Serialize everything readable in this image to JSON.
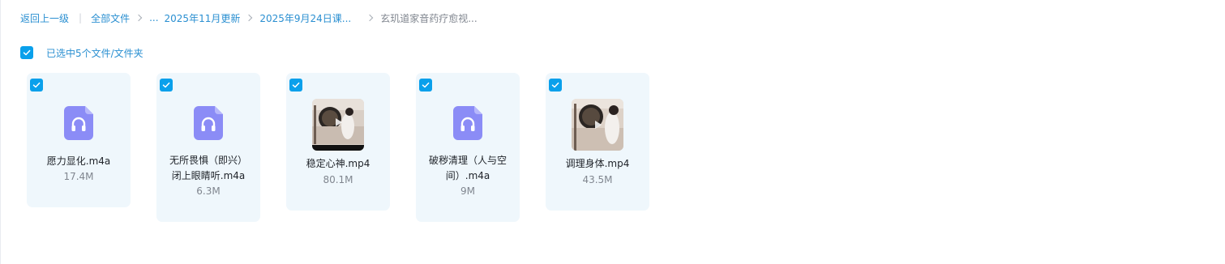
{
  "breadcrumb": {
    "back": "返回上一级",
    "divider": "|",
    "all_files": "全部文件",
    "ellipsis": "...",
    "level1": "2025年11月更新",
    "level2": "2025年9月24日课...",
    "current": "玄玑道家音药疗愈视..."
  },
  "selection": {
    "label": "已选中5个文件/文件夹",
    "checked": true
  },
  "colors": {
    "accent": "#0aa0eb",
    "link": "#2a8fd1",
    "card_bg": "#eff7fc",
    "audio_icon": "#8b8cf6"
  },
  "files": [
    {
      "name_line1": "愿力显化.m4a",
      "name_line2": "",
      "size": "17.4M",
      "icon": "audio-file-icon",
      "checked": true
    },
    {
      "name_line1": "无所畏惧（即兴）",
      "name_line2": "闭上眼睛听.m4a",
      "size": "6.3M",
      "icon": "audio-file-icon",
      "checked": true
    },
    {
      "name_line1": "稳定心神.mp4",
      "name_line2": "",
      "size": "80.1M",
      "icon": "video-thumbnail",
      "checked": true
    },
    {
      "name_line1": "破秽清理（人与空",
      "name_line2": "间）.m4a",
      "size": "9M",
      "icon": "audio-file-icon",
      "checked": true
    },
    {
      "name_line1": "调理身体.mp4",
      "name_line2": "",
      "size": "43.5M",
      "icon": "video-thumbnail",
      "checked": true
    }
  ]
}
